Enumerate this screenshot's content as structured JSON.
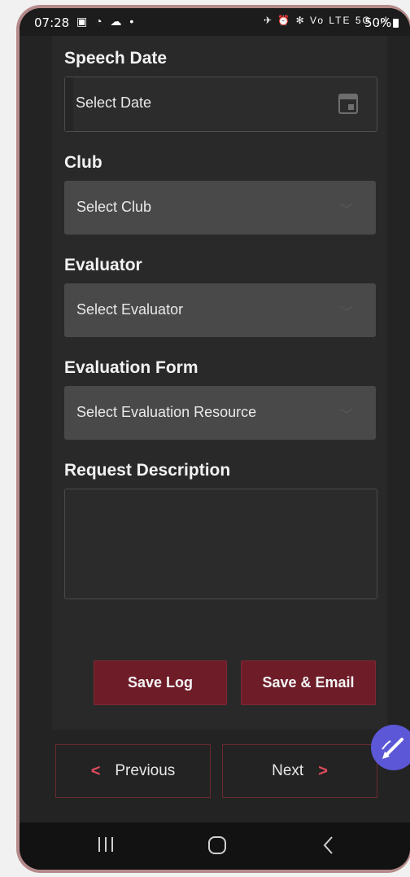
{
  "status_bar": {
    "time": "07:28",
    "left_icons": "▣ ◔ ☁ •",
    "right_icons": "✈ ⏰ ✻ Vo LTE 5G .ıl",
    "battery": "50%"
  },
  "form": {
    "speech_date": {
      "label": "Speech Date",
      "placeholder": "Select Date"
    },
    "club": {
      "label": "Club",
      "placeholder": "Select Club"
    },
    "evaluator": {
      "label": "Evaluator",
      "placeholder": "Select Evaluator"
    },
    "evaluation_form": {
      "label": "Evaluation Form",
      "placeholder": "Select Evaluation Resource"
    },
    "request_description": {
      "label": "Request Description",
      "value": ""
    }
  },
  "actions": {
    "save_log": "Save Log",
    "save_email": "Save & Email"
  },
  "pager": {
    "previous": "Previous",
    "next": "Next",
    "prev_arrow": "<",
    "next_arrow": ">"
  },
  "colors": {
    "accent": "#6d1c28",
    "fab": "#5b57d6",
    "background": "#232323"
  },
  "icons": {
    "calendar": "calendar-icon",
    "chevron": "chevron-down-icon",
    "fab": "pencil-icon"
  }
}
